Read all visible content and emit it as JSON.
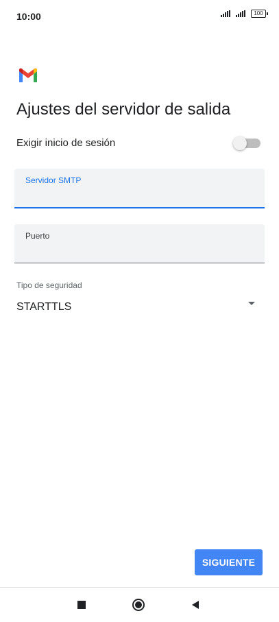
{
  "status_bar": {
    "time": "10:00",
    "battery": "100",
    "icons": [
      "signal-icon",
      "signal-icon",
      "battery-icon"
    ]
  },
  "app": {
    "logo_icon": "gmail-logo-icon"
  },
  "page": {
    "title": "Ajustes del servidor de salida"
  },
  "login": {
    "label": "Exigir inicio de sesión",
    "toggle_on": false
  },
  "smtp_field": {
    "label": "Servidor SMTP",
    "value": ""
  },
  "port_field": {
    "label": "Puerto",
    "value": ""
  },
  "security": {
    "label": "Tipo de seguridad",
    "selected": "STARTTLS",
    "icon": "dropdown-arrow-icon"
  },
  "actions": {
    "next_label": "SIGUIENTE"
  },
  "nav_bar": {
    "icons": [
      "recents-icon",
      "home-icon",
      "back-icon"
    ]
  },
  "colors": {
    "accent": "#1a73e8",
    "button": "#4285f4",
    "field_bg": "#f1f3f4",
    "text": "#202124"
  }
}
